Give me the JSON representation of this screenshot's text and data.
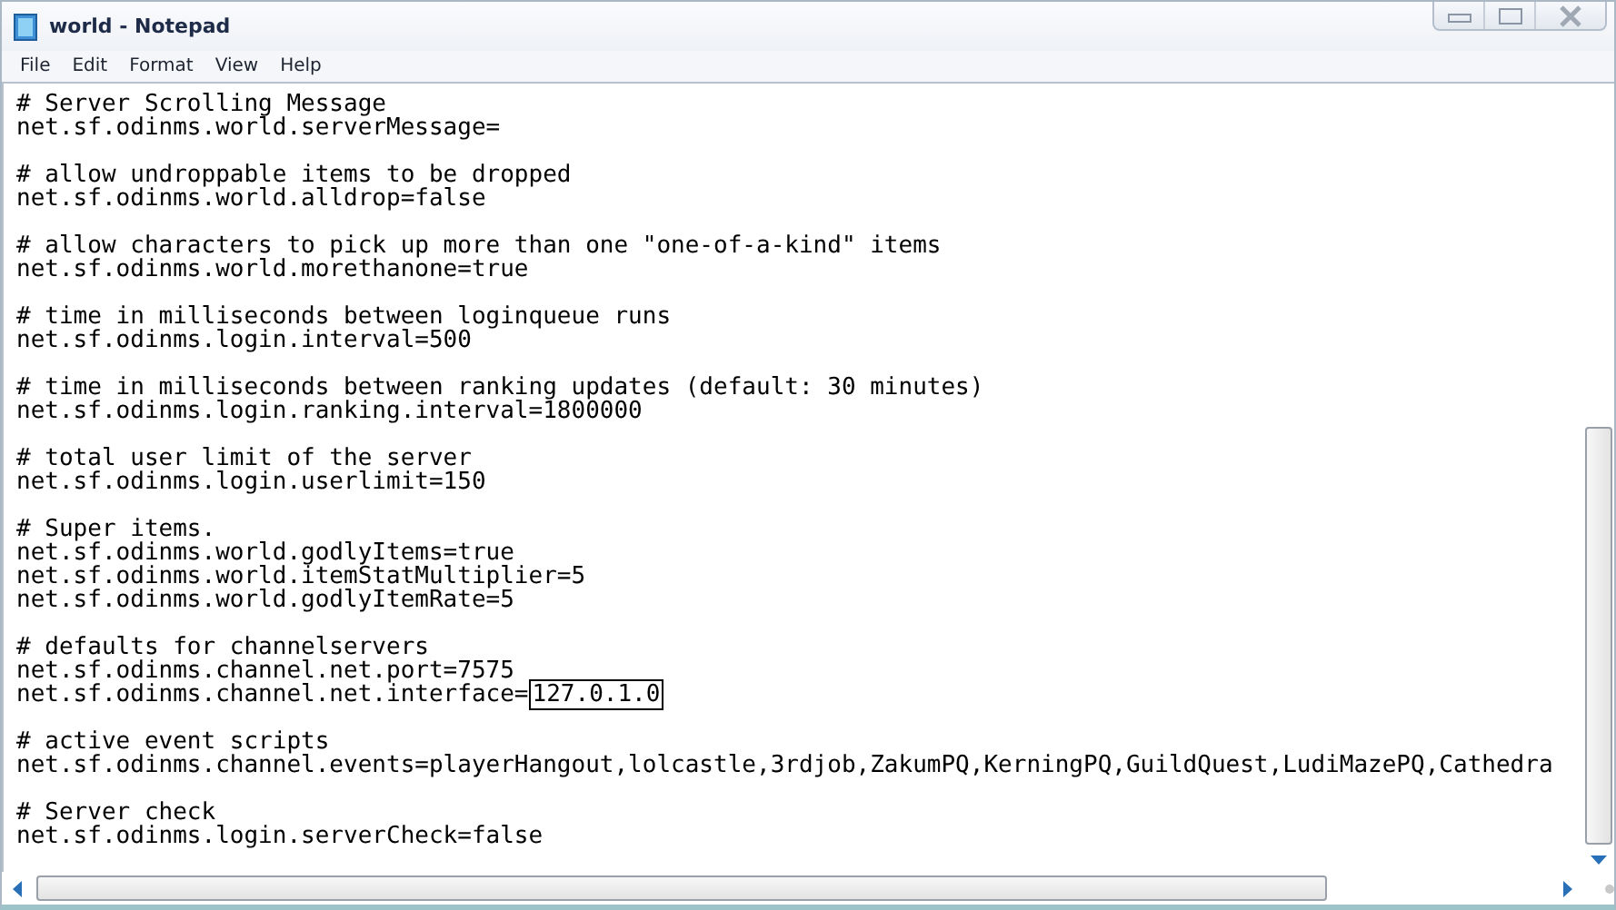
{
  "window": {
    "title": "world - Notepad"
  },
  "menu": [
    "File",
    "Edit",
    "Format",
    "View",
    "Help"
  ],
  "sections": [
    {
      "lines": [
        {
          "text": "# Server Scrolling Message"
        },
        {
          "text": "net.sf.odinms.world.serverMessage="
        }
      ]
    },
    {
      "lines": [
        {
          "text": "# allow undroppable items to be dropped"
        },
        {
          "text": "net.sf.odinms.world.alldrop=false"
        }
      ]
    },
    {
      "lines": [
        {
          "text": "# allow characters to pick up more than one \"one-of-a-kind\" items"
        },
        {
          "text": "net.sf.odinms.world.morethanone=true"
        }
      ]
    },
    {
      "lines": [
        {
          "text": "# time in milliseconds between loginqueue runs"
        },
        {
          "text": "net.sf.odinms.login.interval=500"
        }
      ]
    },
    {
      "lines": [
        {
          "text": "# time in milliseconds between ranking updates (default: 30 minutes)"
        },
        {
          "text": "net.sf.odinms.login.ranking.interval=1800000"
        }
      ]
    },
    {
      "lines": [
        {
          "text": "# total user limit of the server"
        },
        {
          "text": "net.sf.odinms.login.userlimit=150"
        }
      ]
    },
    {
      "lines": [
        {
          "text": "# Super items."
        },
        {
          "text": "net.sf.odinms.world.godlyItems=true"
        },
        {
          "text": "net.sf.odinms.world.itemStatMultiplier=5"
        },
        {
          "text": "net.sf.odinms.world.godlyItemRate=5"
        }
      ]
    },
    {
      "lines": [
        {
          "text": "# defaults for channelservers"
        },
        {
          "text": "net.sf.odinms.channel.net.port=7575"
        },
        {
          "text": "net.sf.odinms.channel.net.interface=",
          "boxed_text": "127.0.1.0"
        }
      ]
    },
    {
      "lines": [
        {
          "text": "# active event scripts"
        },
        {
          "text": "net.sf.odinms.channel.events=playerHangout,lolcastle,3rdjob,ZakumPQ,KerningPQ,GuildQuest,LudiMazePQ,Cathedra"
        }
      ]
    },
    {
      "lines": [
        {
          "text": "# Server check"
        },
        {
          "text": "net.sf.odinms.login.serverCheck=false"
        }
      ]
    }
  ]
}
